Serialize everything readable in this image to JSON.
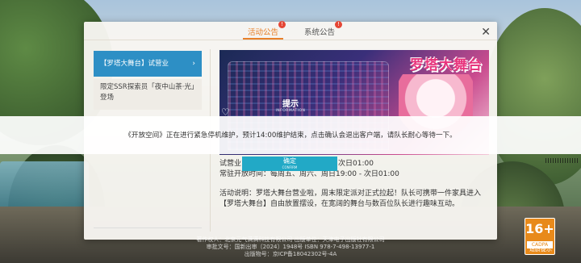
{
  "notice": {
    "tabs": [
      {
        "label": "活动公告",
        "badge": "!",
        "active": true
      },
      {
        "label": "系统公告",
        "badge": "!",
        "active": false
      }
    ],
    "close_symbol": "✕",
    "list": [
      {
        "label": "【罗塔大舞台】试营业",
        "active": true
      },
      {
        "label": "限定SSR探索员「夜中山茶·光」登场",
        "active": false
      }
    ],
    "banner_title": "罗塔大舞台",
    "schedule": [
      {
        "label": "试营业",
        "value": "次日01:00"
      },
      {
        "label": "常驻开放时间：",
        "value": "每周五、周六、周日19:00 - 次日01:00"
      }
    ],
    "description": "活动说明：罗塔大舞台营业啦，周末限定派对正式拉起！队长可携带一件家具进入【罗塔大舞台】自由放置摆设，在宽阔的舞台与数百位队长进行趣味互动。"
  },
  "popup": {
    "title": "提示",
    "title_en": "INFORMATION",
    "message": "《开放空间》正在进行紧急停机维护，预计14:00维护结束，点击确认会退出客户端，请队长耐心等待一下。",
    "confirm_label": "确定",
    "confirm_en": "CONFIRM"
  },
  "footer": {
    "line1": "著作权人：北京元气满满科技有限公司  出版单位：天津电子出版社有限公司",
    "line2": "审批文号：国新出审〔2024〕1948号  ISBN 978-7-498-13977-1",
    "line3": "出版物号：京ICP备18042302号-4A"
  },
  "rating": {
    "age": "16+",
    "sub": "CADPA",
    "label": "适龄提示"
  },
  "colors": {
    "accent": "#e8802a",
    "list_active": "#2d8fc5",
    "confirm": "#22a9c6",
    "badge": "#e54735",
    "rating": "#e88a1b"
  }
}
